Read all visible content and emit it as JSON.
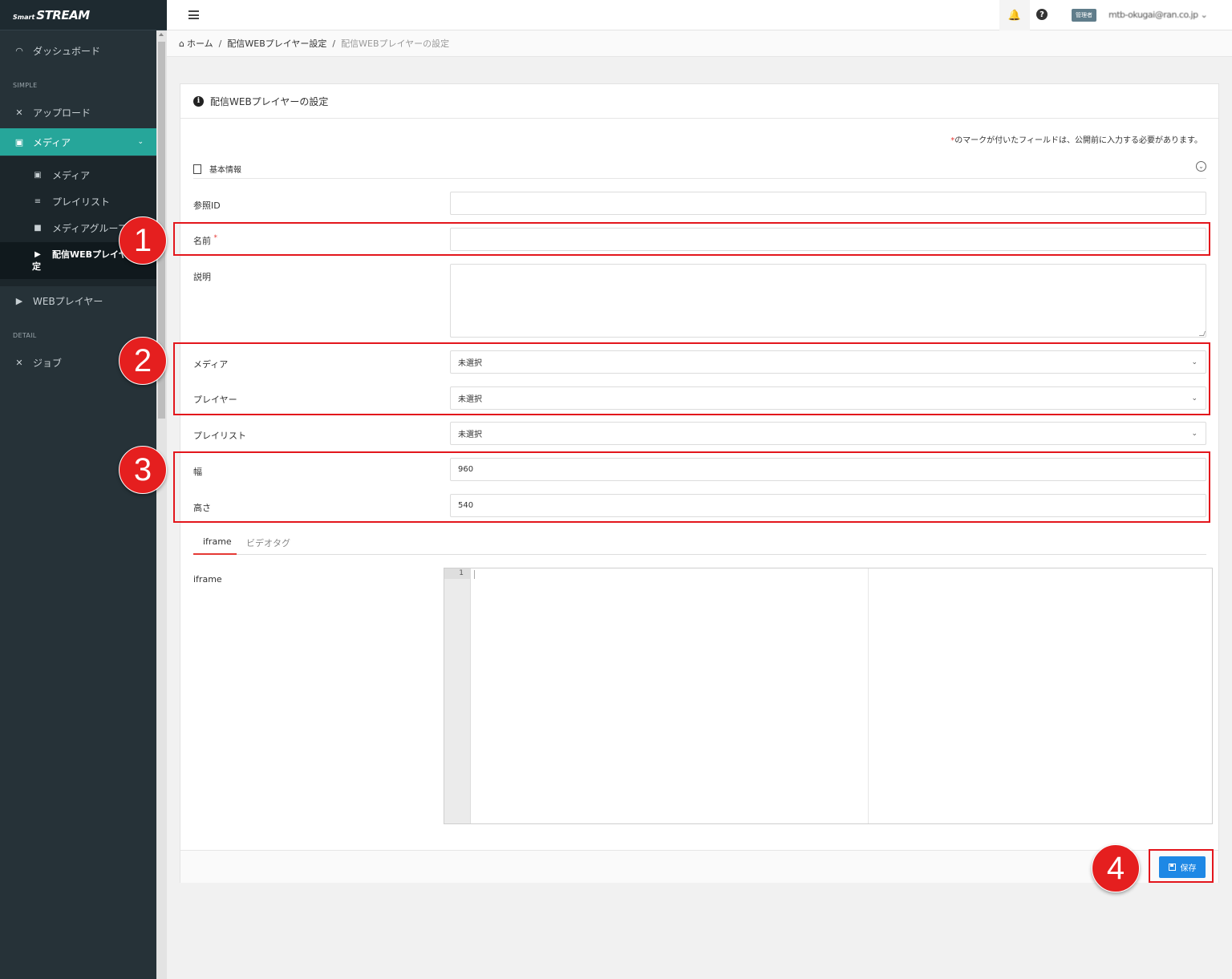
{
  "brand": {
    "small": "Smart",
    "big": "STREAM"
  },
  "sidebar": {
    "dashboard": "ダッシュボード",
    "section_simple": "SIMPLE",
    "upload": "アップロード",
    "media_group": "メディア",
    "sub": [
      {
        "label": "メディア",
        "icon": "film-icon"
      },
      {
        "label": "プレイリスト",
        "icon": "playlist-icon"
      },
      {
        "label": "メディアグループ",
        "icon": "folder-icon"
      },
      {
        "label_line1": "配信WEBプレイヤー設",
        "label_line2": "定",
        "icon": "youtube-icon"
      }
    ],
    "web_player": "WEBプレイヤー",
    "section_detail": "DETAIL",
    "job": "ジョブ"
  },
  "topbar": {
    "role": "管理者",
    "user": "mtb-okugai@ran.co.jp"
  },
  "breadcrumb": {
    "home": "ホーム",
    "level1": "配信WEBプレイヤー設定",
    "current": "配信WEBプレイヤーの設定"
  },
  "card": {
    "title": "配信WEBプレイヤーの設定",
    "required_note_star": "*",
    "required_note": "のマークが付いたフィールドは、公開前に入力する必要があります。",
    "section": "基本情報"
  },
  "form": {
    "ref_id_label": "参照ID",
    "ref_id_value": "",
    "name_label": "名前",
    "name_req": "*",
    "name_value": "",
    "desc_label": "説明",
    "media_label": "メディア",
    "media_value": "未選択",
    "player_label": "プレイヤー",
    "player_value": "未選択",
    "playlist_label": "プレイリスト",
    "playlist_value": "未選択",
    "width_label": "幅",
    "width_value": "960",
    "height_label": "高さ",
    "height_value": "540"
  },
  "tabs": {
    "iframe": "iframe",
    "video": "ビデオタグ"
  },
  "editor": {
    "label": "iframe",
    "line1": "1"
  },
  "save_label": "保存",
  "annotations": [
    "1",
    "2",
    "3",
    "4"
  ],
  "colors": {
    "sidebar_bg": "#263238",
    "active": "#26a69a",
    "primary": "#1e88e5",
    "annotation": "#e3161c"
  }
}
